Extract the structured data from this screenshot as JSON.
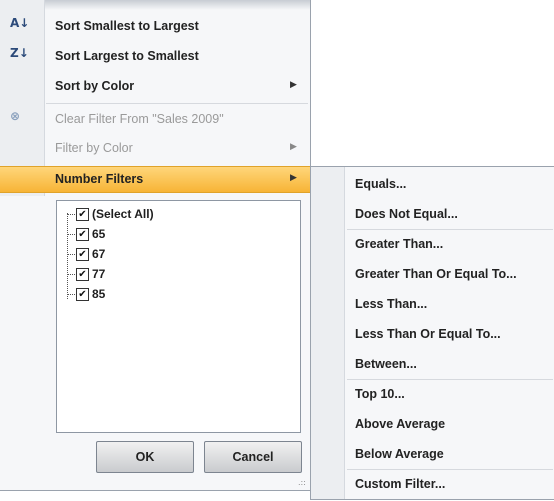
{
  "menu": {
    "items": [
      {
        "label": "Sort Smallest to Largest",
        "icon": "sort-ascending-icon",
        "glyph": "A↓",
        "disabled": false
      },
      {
        "label": "Sort Largest to Smallest",
        "icon": "sort-descending-icon",
        "glyph": "Z↓",
        "disabled": false
      },
      {
        "label": "Sort by Color",
        "disabled": false,
        "submenu": true
      },
      {
        "label": "Clear Filter From \"Sales 2009\"",
        "icon": "clear-filter-icon",
        "glyph": "⊗",
        "disabled": true
      },
      {
        "label": "Filter by Color",
        "disabled": true,
        "submenu": true
      },
      {
        "label": "Number Filters",
        "disabled": false,
        "submenu": true,
        "highlighted": true
      }
    ],
    "arrow_glyph": "▶"
  },
  "checklist": {
    "items": [
      {
        "label": "(Select All)",
        "checked": true
      },
      {
        "label": "65",
        "checked": true
      },
      {
        "label": "67",
        "checked": true
      },
      {
        "label": "77",
        "checked": true
      },
      {
        "label": "85",
        "checked": true
      }
    ],
    "check_glyph": "✔"
  },
  "buttons": {
    "ok": "OK",
    "cancel": "Cancel"
  },
  "resize_grip": ".::",
  "submenu": {
    "items": [
      "Equals...",
      "Does Not Equal...",
      "Greater Than...",
      "Greater Than Or Equal To...",
      "Less Than...",
      "Less Than Or Equal To...",
      "Between...",
      "Top 10...",
      "Above Average",
      "Below Average",
      "Custom Filter..."
    ]
  },
  "colors": {
    "highlight": "#f7b436",
    "menu_bg": "#f6f7f9"
  }
}
